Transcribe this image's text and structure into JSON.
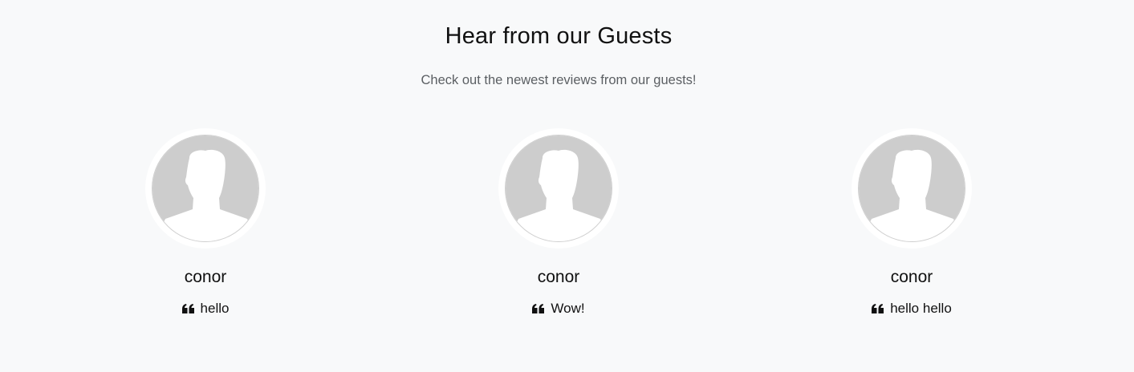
{
  "header": {
    "title": "Hear from our Guests",
    "subtitle": "Check out the newest reviews from our guests!"
  },
  "reviews": [
    {
      "name": "conor",
      "text": "hello",
      "avatar_icon": "user-silhouette-icon",
      "quote_icon": "quote-left-icon"
    },
    {
      "name": "conor",
      "text": "Wow!",
      "avatar_icon": "user-silhouette-icon",
      "quote_icon": "quote-left-icon"
    },
    {
      "name": "conor",
      "text": "hello hello",
      "avatar_icon": "user-silhouette-icon",
      "quote_icon": "quote-left-icon"
    }
  ],
  "colors": {
    "background": "#f8f9fa",
    "avatar_fill": "#cdcdcd",
    "subtitle": "#5b5f63"
  }
}
